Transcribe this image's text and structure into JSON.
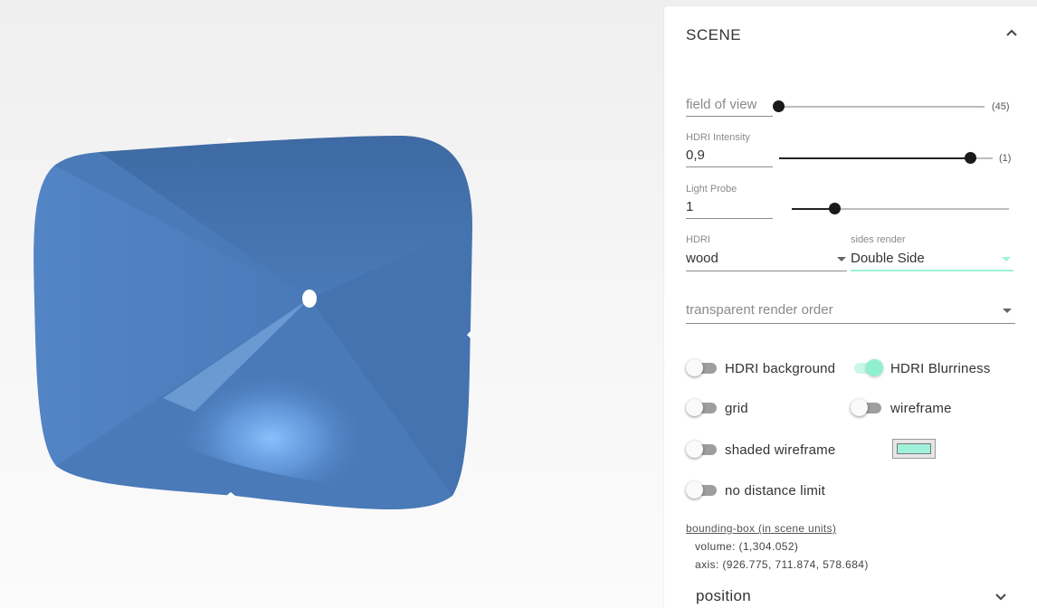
{
  "viewport": {
    "mesh_color": "#4a7ab8",
    "highlight_color": "#7fb7f2",
    "background_color": "#f4f4f4"
  },
  "panel": {
    "title": "SCENE",
    "collapse_icon": "chevron-up-icon",
    "field_of_view": {
      "label": "field of view",
      "value_display": "(45)",
      "value_fraction": 0.0
    },
    "hdri_intensity": {
      "label": "HDRI Intensity",
      "value": "0,9",
      "value_display": "(1)",
      "value_fraction": 0.9
    },
    "light_probe": {
      "label": "Light Probe",
      "value": "1",
      "value_fraction": 0.2
    },
    "hdri": {
      "label": "HDRI",
      "value": "wood"
    },
    "sides_render": {
      "label": "sides render",
      "value": "Double Side"
    },
    "transparent_render_order": {
      "placeholder": "transparent render order"
    },
    "toggles": {
      "hdri_background": {
        "label": "HDRI background",
        "on": false
      },
      "hdri_blurriness": {
        "label": "HDRI Blurriness",
        "on": true
      },
      "grid": {
        "label": "grid",
        "on": false
      },
      "wireframe": {
        "label": "wireframe",
        "on": false
      },
      "shaded_wireframe": {
        "label": "shaded wireframe",
        "on": false
      },
      "no_distance_limit": {
        "label": "no distance limit",
        "on": false
      }
    },
    "wireframe_color": "#9ff2d9",
    "bounding_box": {
      "title": "bounding-box (in scene units)",
      "volume": "volume: (1,304.052)",
      "axis": "axis: (926.775, 711.874, 578.684)"
    },
    "position": {
      "label": "position",
      "icon": "chevron-down-icon"
    },
    "accent_color": "#9ff2d9"
  }
}
